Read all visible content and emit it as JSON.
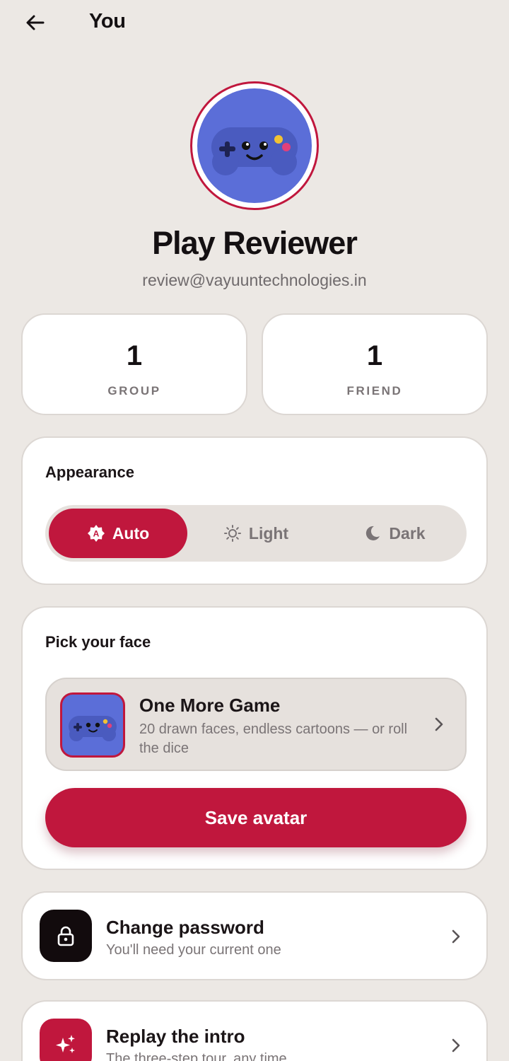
{
  "header": {
    "title": "You",
    "back_icon": "arrow-left-icon"
  },
  "profile": {
    "name": "Play Reviewer",
    "email": "review@vayuuntechnologies.in",
    "avatar_icon": "gamepad-face-icon"
  },
  "stats": [
    {
      "value": "1",
      "label": "GROUP"
    },
    {
      "value": "1",
      "label": "FRIEND"
    }
  ],
  "appearance": {
    "heading": "Appearance",
    "options": [
      {
        "label": "Auto",
        "icon": "auto-theme-icon",
        "selected": true
      },
      {
        "label": "Light",
        "icon": "sun-icon",
        "selected": false
      },
      {
        "label": "Dark",
        "icon": "moon-icon",
        "selected": false
      }
    ]
  },
  "face": {
    "heading": "Pick your face",
    "pack_title": "One More Game",
    "pack_description": "20 drawn faces, endless cartoons — or roll the dice",
    "save_label": "Save avatar"
  },
  "rows": [
    {
      "title": "Change password",
      "subtitle": "You'll need your current one",
      "icon": "lock-icon"
    },
    {
      "title": "Replay the intro",
      "subtitle": "The three-step tour, any time",
      "icon": "sparkles-icon"
    }
  ],
  "colors": {
    "accent": "#c0173d",
    "background": "#ece8e4",
    "avatar_blue": "#5b6ed8",
    "card": "#ffffff"
  }
}
